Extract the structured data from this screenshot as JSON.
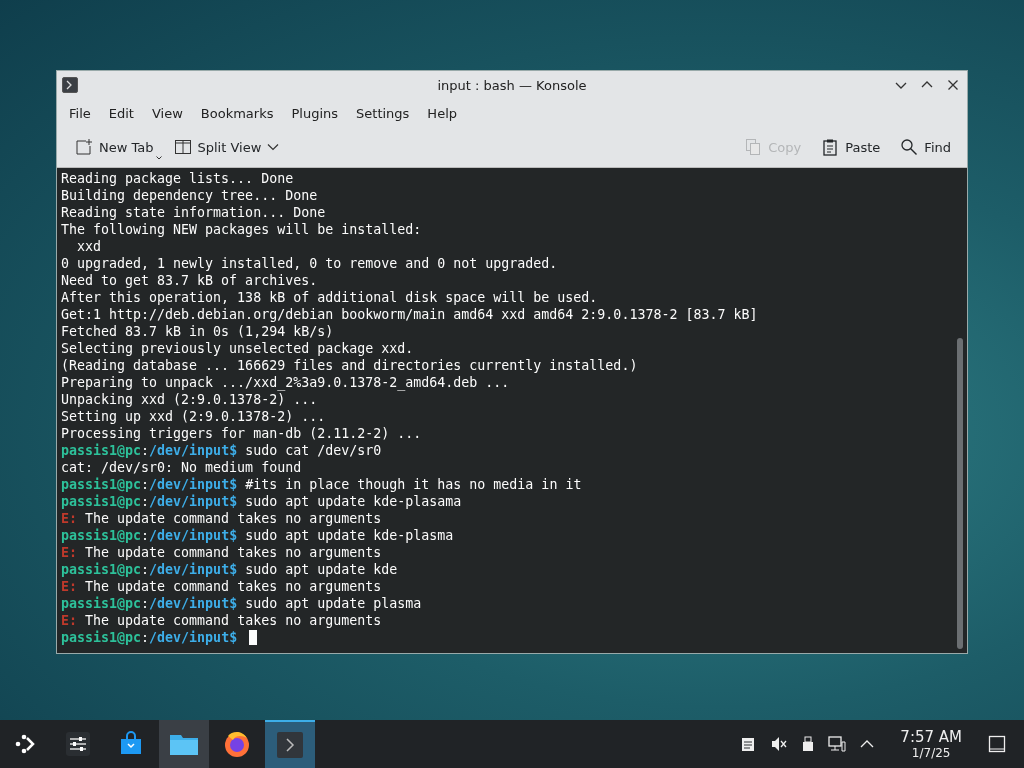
{
  "window": {
    "title": "input : bash — Konsole"
  },
  "menu": [
    "File",
    "Edit",
    "View",
    "Bookmarks",
    "Plugins",
    "Settings",
    "Help"
  ],
  "toolbar": {
    "left": [
      {
        "kind": "newtab",
        "label": "New Tab",
        "disabled": false
      },
      {
        "kind": "split",
        "label": "Split View",
        "disabled": false
      }
    ],
    "right": [
      {
        "kind": "copy",
        "label": "Copy",
        "disabled": true
      },
      {
        "kind": "paste",
        "label": "Paste",
        "disabled": false
      },
      {
        "kind": "find",
        "label": "Find",
        "disabled": false
      }
    ]
  },
  "terminal": {
    "lines": [
      {
        "kind": "output",
        "text": "Reading package lists... Done"
      },
      {
        "kind": "output",
        "text": "Building dependency tree... Done"
      },
      {
        "kind": "output",
        "text": "Reading state information... Done"
      },
      {
        "kind": "output",
        "text": "The following NEW packages will be installed:"
      },
      {
        "kind": "output",
        "text": "  xxd"
      },
      {
        "kind": "output",
        "text": "0 upgraded, 1 newly installed, 0 to remove and 0 not upgraded."
      },
      {
        "kind": "output",
        "text": "Need to get 83.7 kB of archives."
      },
      {
        "kind": "output",
        "text": "After this operation, 138 kB of additional disk space will be used."
      },
      {
        "kind": "output",
        "text": "Get:1 http://deb.debian.org/debian bookworm/main amd64 xxd amd64 2:9.0.1378-2 [83.7 kB]"
      },
      {
        "kind": "output",
        "text": "Fetched 83.7 kB in 0s (1,294 kB/s)"
      },
      {
        "kind": "output",
        "text": "Selecting previously unselected package xxd."
      },
      {
        "kind": "output",
        "text": "(Reading database ... 166629 files and directories currently installed.)"
      },
      {
        "kind": "output",
        "text": "Preparing to unpack .../xxd_2%3a9.0.1378-2_amd64.deb ..."
      },
      {
        "kind": "output",
        "text": "Unpacking xxd (2:9.0.1378-2) ..."
      },
      {
        "kind": "output",
        "text": "Setting up xxd (2:9.0.1378-2) ..."
      },
      {
        "kind": "output",
        "text": "Processing triggers for man-db (2.11.2-2) ..."
      },
      {
        "kind": "prompt",
        "user": "passis1@pc",
        "colon": ":",
        "path": "/dev/input",
        "dollar": "$",
        "command": "sudo cat /dev/sr0"
      },
      {
        "kind": "output",
        "text": "cat: /dev/sr0: No medium found"
      },
      {
        "kind": "prompt",
        "user": "passis1@pc",
        "colon": ":",
        "path": "/dev/input",
        "dollar": "$",
        "command": "#its in place though it has no media in it"
      },
      {
        "kind": "prompt",
        "user": "passis1@pc",
        "colon": ":",
        "path": "/dev/input",
        "dollar": "$",
        "command": "sudo apt update kde-plasama"
      },
      {
        "kind": "error",
        "label": "E:",
        "text": "The update command takes no arguments"
      },
      {
        "kind": "prompt",
        "user": "passis1@pc",
        "colon": ":",
        "path": "/dev/input",
        "dollar": "$",
        "command": "sudo apt update kde-plasma"
      },
      {
        "kind": "error",
        "label": "E:",
        "text": "The update command takes no arguments"
      },
      {
        "kind": "prompt",
        "user": "passis1@pc",
        "colon": ":",
        "path": "/dev/input",
        "dollar": "$",
        "command": "sudo apt update kde"
      },
      {
        "kind": "error",
        "label": "E:",
        "text": "The update command takes no arguments"
      },
      {
        "kind": "prompt",
        "user": "passis1@pc",
        "colon": ":",
        "path": "/dev/input",
        "dollar": "$",
        "command": "sudo apt update plasma"
      },
      {
        "kind": "error",
        "label": "E:",
        "text": "The update command takes no arguments"
      },
      {
        "kind": "prompt",
        "user": "passis1@pc",
        "colon": ":",
        "path": "/dev/input",
        "dollar": "$"
      }
    ]
  },
  "taskbar": {
    "apps": [
      {
        "kind": "launcher",
        "selected": false,
        "running": false
      },
      {
        "kind": "settings",
        "selected": false,
        "running": false
      },
      {
        "kind": "store",
        "selected": false,
        "running": false
      },
      {
        "kind": "files",
        "selected": false,
        "running": true
      },
      {
        "kind": "browser",
        "selected": false,
        "running": false
      },
      {
        "kind": "terminal",
        "selected": true,
        "running": true
      }
    ],
    "clock": {
      "time": "7:57 AM",
      "date": "1/7/25"
    }
  }
}
